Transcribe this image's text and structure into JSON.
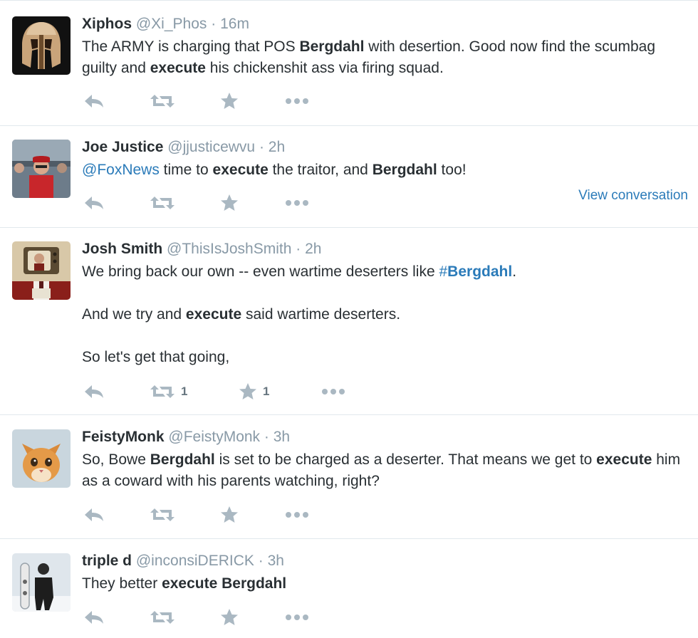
{
  "tweets": [
    {
      "fullname": "Xiphos",
      "screen_name": "@Xi_Phos",
      "sep": "·",
      "time": "16m",
      "avatar": "spartan-helmet-avatar",
      "text": {
        "p1_a": "The ARMY is charging that POS ",
        "p1_b": "Bergdahl",
        "p1_c": " with desertion. Good now find the scumbag guilty and ",
        "p1_d": "execute",
        "p1_e": " his chickenshit ass via firing squad."
      }
    },
    {
      "fullname": "Joe Justice",
      "screen_name": "@jjusticewvu",
      "sep": "·",
      "time": "2h",
      "avatar": "baseball-fan-avatar",
      "text": {
        "mention": "@FoxNews",
        "p1_a": " time to ",
        "p1_b": "execute",
        "p1_c": " the traitor, and ",
        "p1_d": "Bergdahl",
        "p1_e": " too!"
      },
      "view_conversation": "View conversation"
    },
    {
      "fullname": "Josh Smith",
      "screen_name": "@ThisIsJoshSmith",
      "sep": "·",
      "time": "2h",
      "avatar": "tv-head-avatar",
      "text": {
        "p1_a": "We bring back our own -- even wartime deserters like ",
        "hashtag_hash": "#",
        "hashtag_word": "Bergdahl",
        "p1_end": ".",
        "p2_a": "And we try and ",
        "p2_b": "execute",
        "p2_c": " said wartime deserters.",
        "p3": "So let's get that going,"
      },
      "retweet_count": "1",
      "favorite_count": "1"
    },
    {
      "fullname": "FeistyMonk",
      "screen_name": "@FeistyMonk",
      "sep": "·",
      "time": "3h",
      "avatar": "kitten-avatar",
      "text": {
        "p1_a": "So, Bowe ",
        "p1_b": "Bergdahl",
        "p1_c": " is set to be charged as a deserter. That means we get to ",
        "p1_d": "execute",
        "p1_e": " him as a coward with his parents watching, right?"
      }
    },
    {
      "fullname": "triple d",
      "screen_name": "@inconsiDERICK",
      "sep": "·",
      "time": "3h",
      "avatar": "snowboarder-avatar",
      "text": {
        "p1_a": "They better ",
        "p1_b": "execute",
        "p1_c": " ",
        "p1_d": "Bergdahl"
      }
    }
  ],
  "colors": {
    "name": "#292f33",
    "meta": "#8899a6",
    "link": "#2b7bb9",
    "action_icon": "#aab8c2",
    "divider": "#e1e8ed"
  },
  "action_icons": [
    "reply-icon",
    "retweet-icon",
    "favorite-icon",
    "more-icon"
  ]
}
